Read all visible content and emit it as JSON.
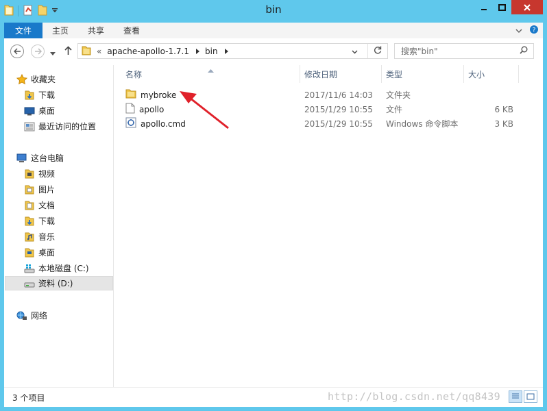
{
  "window": {
    "title": "bin"
  },
  "ribbon": {
    "tabs": [
      {
        "label": "文件",
        "active": true
      },
      {
        "label": "主页"
      },
      {
        "label": "共享"
      },
      {
        "label": "查看"
      }
    ]
  },
  "address": {
    "overflow": "«",
    "path": [
      "apache-apollo-1.7.1",
      "bin"
    ]
  },
  "search": {
    "placeholder": "搜索\"bin\""
  },
  "nav": {
    "favorites": {
      "label": "收藏夹",
      "items": [
        {
          "label": "下载",
          "icon": "downloads-folder-icon"
        },
        {
          "label": "桌面",
          "icon": "desktop-icon"
        },
        {
          "label": "最近访问的位置",
          "icon": "recent-places-icon"
        }
      ]
    },
    "computer": {
      "label": "这台电脑",
      "items": [
        {
          "label": "视频",
          "icon": "videos-folder-icon"
        },
        {
          "label": "图片",
          "icon": "pictures-folder-icon"
        },
        {
          "label": "文档",
          "icon": "documents-folder-icon"
        },
        {
          "label": "下载",
          "icon": "downloads-folder-icon"
        },
        {
          "label": "音乐",
          "icon": "music-folder-icon"
        },
        {
          "label": "桌面",
          "icon": "desktop-folder-icon"
        },
        {
          "label": "本地磁盘 (C:)",
          "icon": "system-drive-icon"
        },
        {
          "label": "资料 (D:)",
          "icon": "drive-icon",
          "selected": true
        }
      ]
    },
    "network": {
      "label": "网络"
    }
  },
  "columns": {
    "name": "名称",
    "modified": "修改日期",
    "type": "类型",
    "size": "大小"
  },
  "files": [
    {
      "name": "mybroke",
      "modified": "2017/11/6 14:03",
      "type": "文件夹",
      "size": "",
      "icon": "folder-icon"
    },
    {
      "name": "apollo",
      "modified": "2015/1/29 10:55",
      "type": "文件",
      "size": "6 KB",
      "icon": "file-icon"
    },
    {
      "name": "apollo.cmd",
      "modified": "2015/1/29 10:55",
      "type": "Windows 命令脚本",
      "size": "3 KB",
      "icon": "cmd-script-icon"
    }
  ],
  "status": {
    "count": "3 个项目"
  },
  "watermark": "http://blog.csdn.net/qq8439",
  "colors": {
    "accent": "#1979ca",
    "titlebar": "#5fc8ec",
    "close": "#c7372e",
    "arrow": "#e0212a"
  }
}
